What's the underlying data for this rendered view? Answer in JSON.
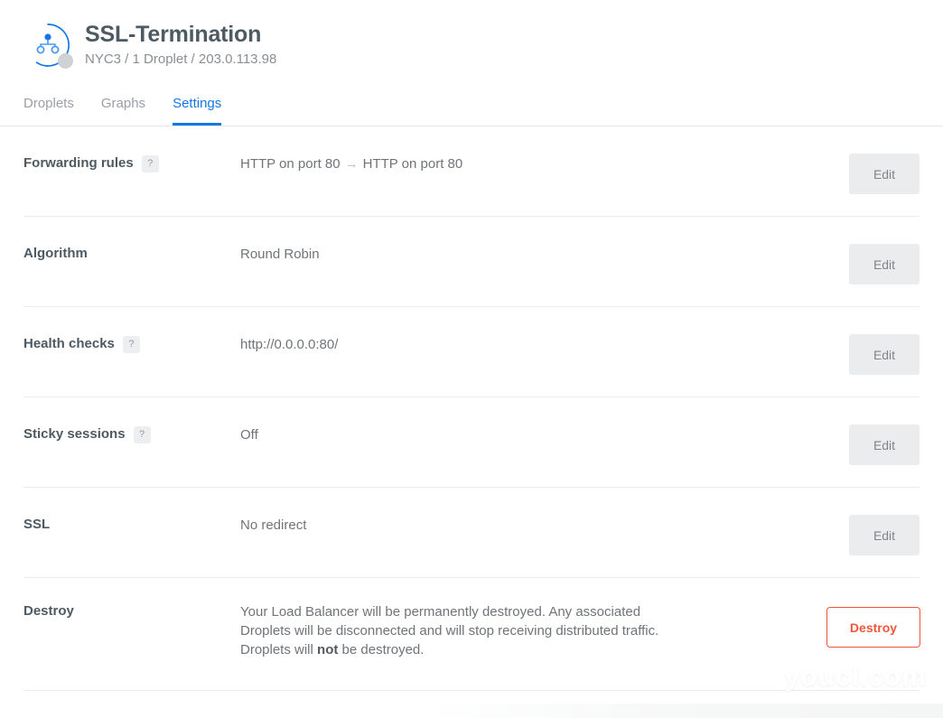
{
  "header": {
    "icon": "load-balancer-icon",
    "status_dot_color": "#cfd2d4",
    "title": "SSL-Termination",
    "subtitle": "NYC3 / 1 Droplet / 203.0.113.98"
  },
  "tabs": [
    {
      "label": "Droplets",
      "active": false
    },
    {
      "label": "Graphs",
      "active": false
    },
    {
      "label": "Settings",
      "active": true
    }
  ],
  "accent_color": "#1577e3",
  "danger_color": "#f0563c",
  "settings": [
    {
      "label": "Forwarding rules",
      "help": "?",
      "has_help": true,
      "value_prefix": "HTTP on port 80",
      "arrow": "→",
      "value_suffix": "HTTP on port 80",
      "action": "Edit"
    },
    {
      "label": "Algorithm",
      "has_help": false,
      "value": "Round Robin",
      "action": "Edit"
    },
    {
      "label": "Health checks",
      "help": "?",
      "has_help": true,
      "value": "http://0.0.0.0:80/",
      "action": "Edit"
    },
    {
      "label": "Sticky sessions",
      "help": "?",
      "has_help": true,
      "value": "Off",
      "action": "Edit"
    },
    {
      "label": "SSL",
      "has_help": false,
      "value": "No redirect",
      "action": "Edit"
    }
  ],
  "destroy": {
    "label": "Destroy",
    "description_part1": "Your Load Balancer will be permanently destroyed. Any associated Droplets will be disconnected and will stop receiving distributed traffic. Droplets will ",
    "description_bold": "not",
    "description_part2": " be destroyed.",
    "action": "Destroy"
  },
  "watermark": "youcl.com"
}
